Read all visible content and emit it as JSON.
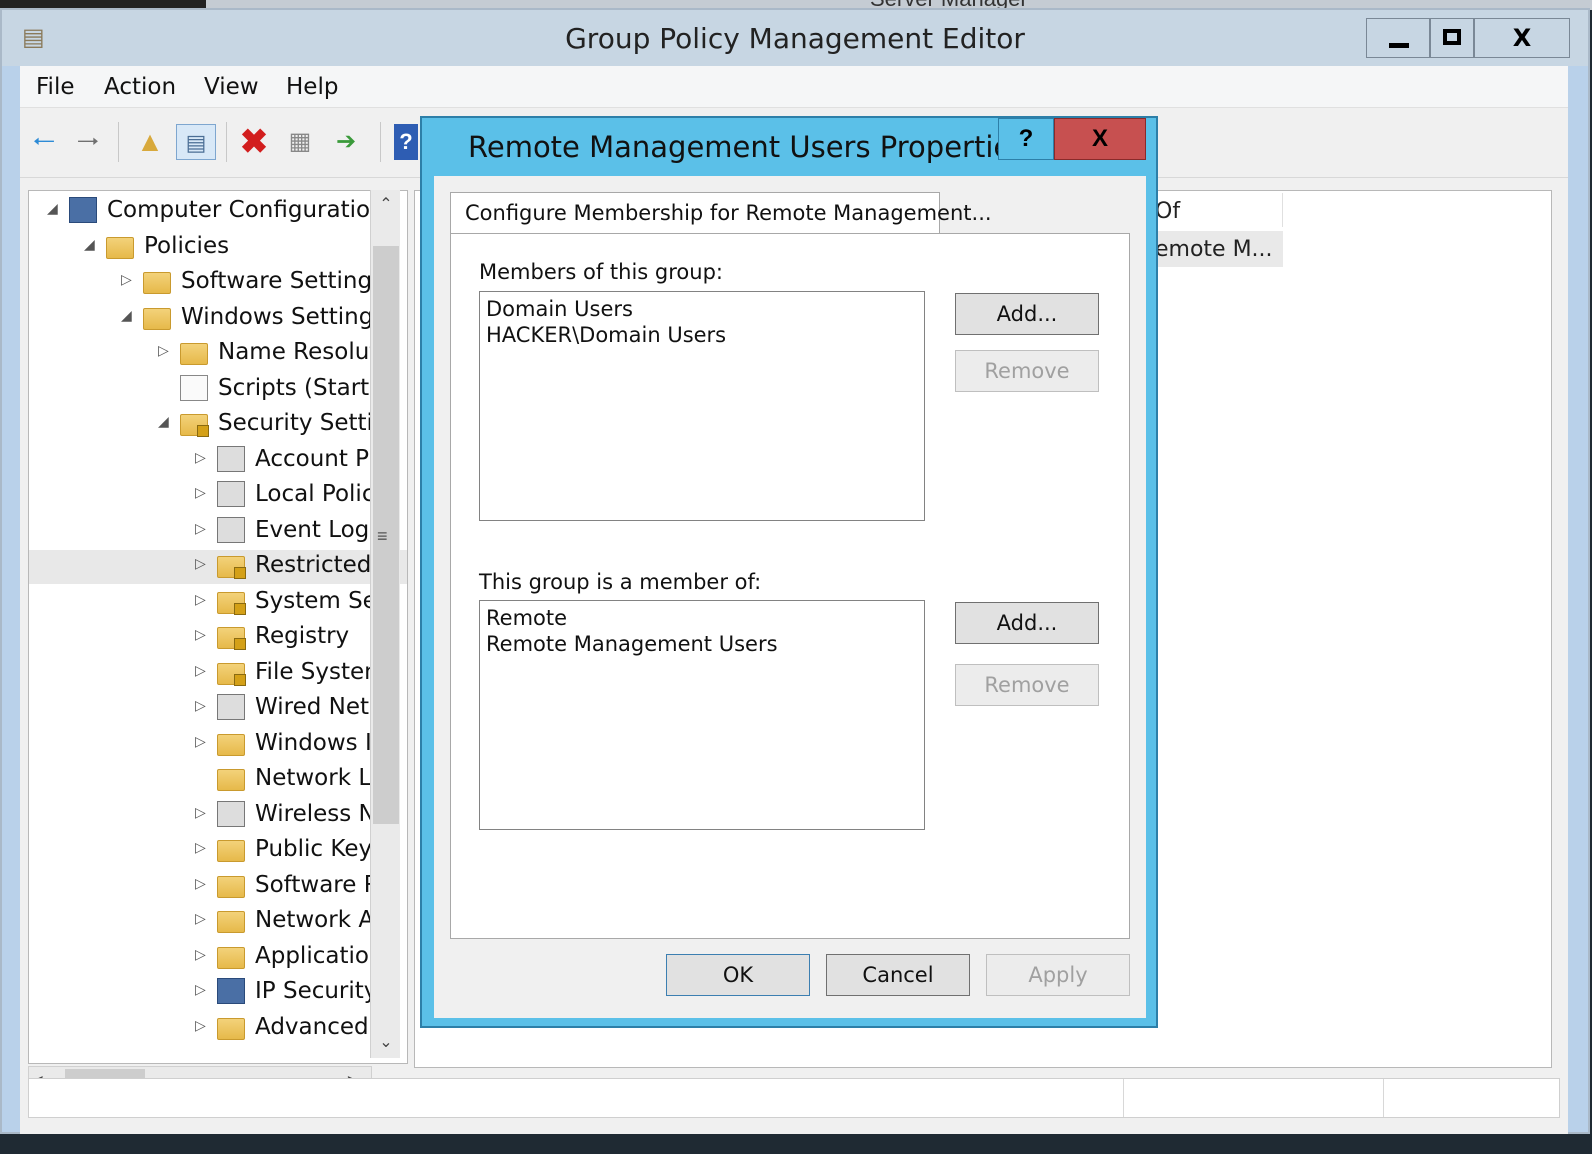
{
  "backdrop": {
    "title": "Server Manager"
  },
  "window": {
    "title": "Group Policy Management Editor",
    "minimize": "",
    "maximize": "",
    "close": "X"
  },
  "menu": {
    "file": "File",
    "action": "Action",
    "view": "View",
    "help": "Help"
  },
  "toolbar": {
    "back_icon": "back-arrow-icon",
    "forward_icon": "forward-arrow-icon",
    "up_icon": "up-folder-icon",
    "tree_icon": "show-hide-console-tree-icon",
    "delete_icon": "delete-icon",
    "properties_icon": "properties-icon",
    "export_icon": "export-list-icon",
    "help_icon": "help-icon"
  },
  "tree": {
    "items": [
      {
        "label": "Computer Configuration",
        "expander": "◢",
        "icon": "computer"
      },
      {
        "label": "Policies",
        "expander": "◢",
        "icon": "folder"
      },
      {
        "label": "Software Settings",
        "expander": "▷",
        "icon": "folder"
      },
      {
        "label": "Windows Settings",
        "expander": "◢",
        "icon": "folder"
      },
      {
        "label": "Name Resolut",
        "expander": "▷",
        "icon": "folder"
      },
      {
        "label": "Scripts (Startu",
        "expander": "",
        "icon": "doc"
      },
      {
        "label": "Security Settir",
        "expander": "◢",
        "icon": "folder-lock"
      },
      {
        "label": "Account P",
        "expander": "▷",
        "icon": "server"
      },
      {
        "label": "Local Polic",
        "expander": "▷",
        "icon": "server"
      },
      {
        "label": "Event Log",
        "expander": "▷",
        "icon": "server"
      },
      {
        "label": "Restricted",
        "expander": "▷",
        "icon": "folder-lock",
        "selected": true
      },
      {
        "label": "System Se",
        "expander": "▷",
        "icon": "folder-lock"
      },
      {
        "label": "Registry",
        "expander": "▷",
        "icon": "folder-lock"
      },
      {
        "label": "File Systen",
        "expander": "▷",
        "icon": "folder-lock"
      },
      {
        "label": "Wired Net",
        "expander": "▷",
        "icon": "server"
      },
      {
        "label": "Windows I",
        "expander": "▷",
        "icon": "folder"
      },
      {
        "label": "Network L",
        "expander": "",
        "icon": "folder"
      },
      {
        "label": "Wireless N",
        "expander": "▷",
        "icon": "server"
      },
      {
        "label": "Public Key",
        "expander": "▷",
        "icon": "folder"
      },
      {
        "label": "Software R",
        "expander": "▷",
        "icon": "folder"
      },
      {
        "label": "Network A",
        "expander": "▷",
        "icon": "folder"
      },
      {
        "label": "Applicatio",
        "expander": "▷",
        "icon": "folder"
      },
      {
        "label": "IP Security",
        "expander": "▷",
        "icon": "computer"
      },
      {
        "label": "Advanced",
        "expander": "▷",
        "icon": "folder"
      }
    ]
  },
  "detail": {
    "column_header": "Of",
    "cell": "emote M..."
  },
  "dialog": {
    "title": "Remote Management Users Properties",
    "help": "?",
    "close": "X",
    "tab": "Configure Membership for Remote Management...",
    "members_label": "Members of this group:",
    "members": [
      "Domain Users",
      "HACKER\\Domain Users"
    ],
    "memberof_label": "This group is a member of:",
    "memberof": [
      "Remote",
      "Remote Management Users"
    ],
    "add": "Add...",
    "remove": "Remove",
    "ok": "OK",
    "cancel": "Cancel",
    "apply": "Apply"
  },
  "colors": {
    "dialog_frame": "#5bc0e8",
    "close_button": "#c75050",
    "window_frame": "#b9d1ea"
  }
}
